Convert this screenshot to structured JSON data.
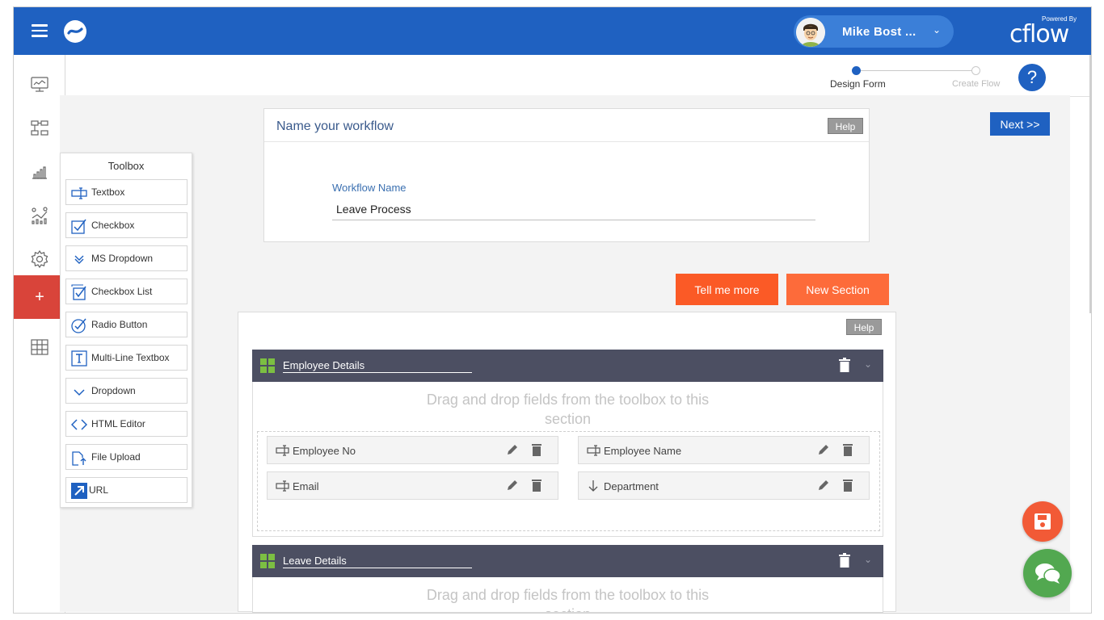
{
  "header": {
    "user_name": "Mike Bost ...",
    "powered_by": "Powered By",
    "brand": "cflow"
  },
  "steps": [
    {
      "label": "Design Form",
      "active": true
    },
    {
      "label": "Create Flow",
      "active": false
    }
  ],
  "help_icon": "?",
  "next_label": "Next >>",
  "toolbox": {
    "title": "Toolbox",
    "items": [
      {
        "label": "Textbox",
        "icon": "textbox-icon"
      },
      {
        "label": "Checkbox",
        "icon": "checkbox-icon"
      },
      {
        "label": "MS Dropdown",
        "icon": "double-chevron-icon"
      },
      {
        "label": "Checkbox List",
        "icon": "checkbox-list-icon"
      },
      {
        "label": "Radio Button",
        "icon": "radio-check-icon"
      },
      {
        "label": "Multi-Line Textbox",
        "icon": "text-area-icon"
      },
      {
        "label": "Dropdown",
        "icon": "chevron-down-icon"
      },
      {
        "label": "HTML Editor",
        "icon": "code-icon"
      },
      {
        "label": "File Upload",
        "icon": "file-upload-icon"
      },
      {
        "label": "URL",
        "icon": "link-arrow-icon"
      }
    ]
  },
  "workflow": {
    "card_title": "Name your workflow",
    "help": "Help",
    "field_label": "Workflow Name",
    "field_value": "Leave Process"
  },
  "buttons": {
    "tell_more": "Tell me more",
    "new_section": "New Section"
  },
  "sections_help": "Help",
  "drop_hint_line1": "Drag and drop fields from the toolbox to this",
  "drop_hint_line2": "section",
  "sections": [
    {
      "title": "Employee Details",
      "fields": [
        {
          "label": "Employee No",
          "icon": "textbox-icon"
        },
        {
          "label": "Employee Name",
          "icon": "textbox-icon"
        },
        {
          "label": "Email",
          "icon": "textbox-icon"
        },
        {
          "label": "Department",
          "icon": "arrow-down-icon"
        }
      ]
    },
    {
      "title": "Leave Details",
      "fields": []
    }
  ],
  "colors": {
    "primary_blue": "#1f61c1",
    "accent_orange": "#fb5a26",
    "section_bar": "#4c4f62",
    "section_icon_green": "#7cbf42",
    "rail_active_red": "#d9443a",
    "chat_green": "#52a850"
  }
}
